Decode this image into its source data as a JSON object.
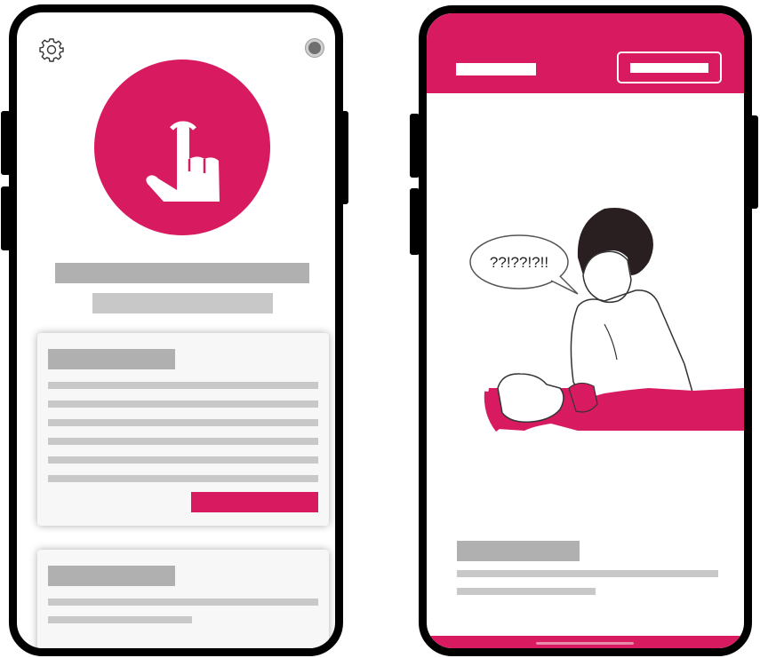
{
  "colors": {
    "accent": "#d81b60",
    "placeholder": "#b0b0b0",
    "card_bg": "#f7f7f7"
  },
  "left_phone": {
    "icons": {
      "settings": "gear-icon",
      "camera": "camera-dot-icon",
      "hero": "tap-hand-icon"
    }
  },
  "right_phone": {
    "illustration": {
      "speech_bubble_text": "??!??!?!!"
    }
  }
}
